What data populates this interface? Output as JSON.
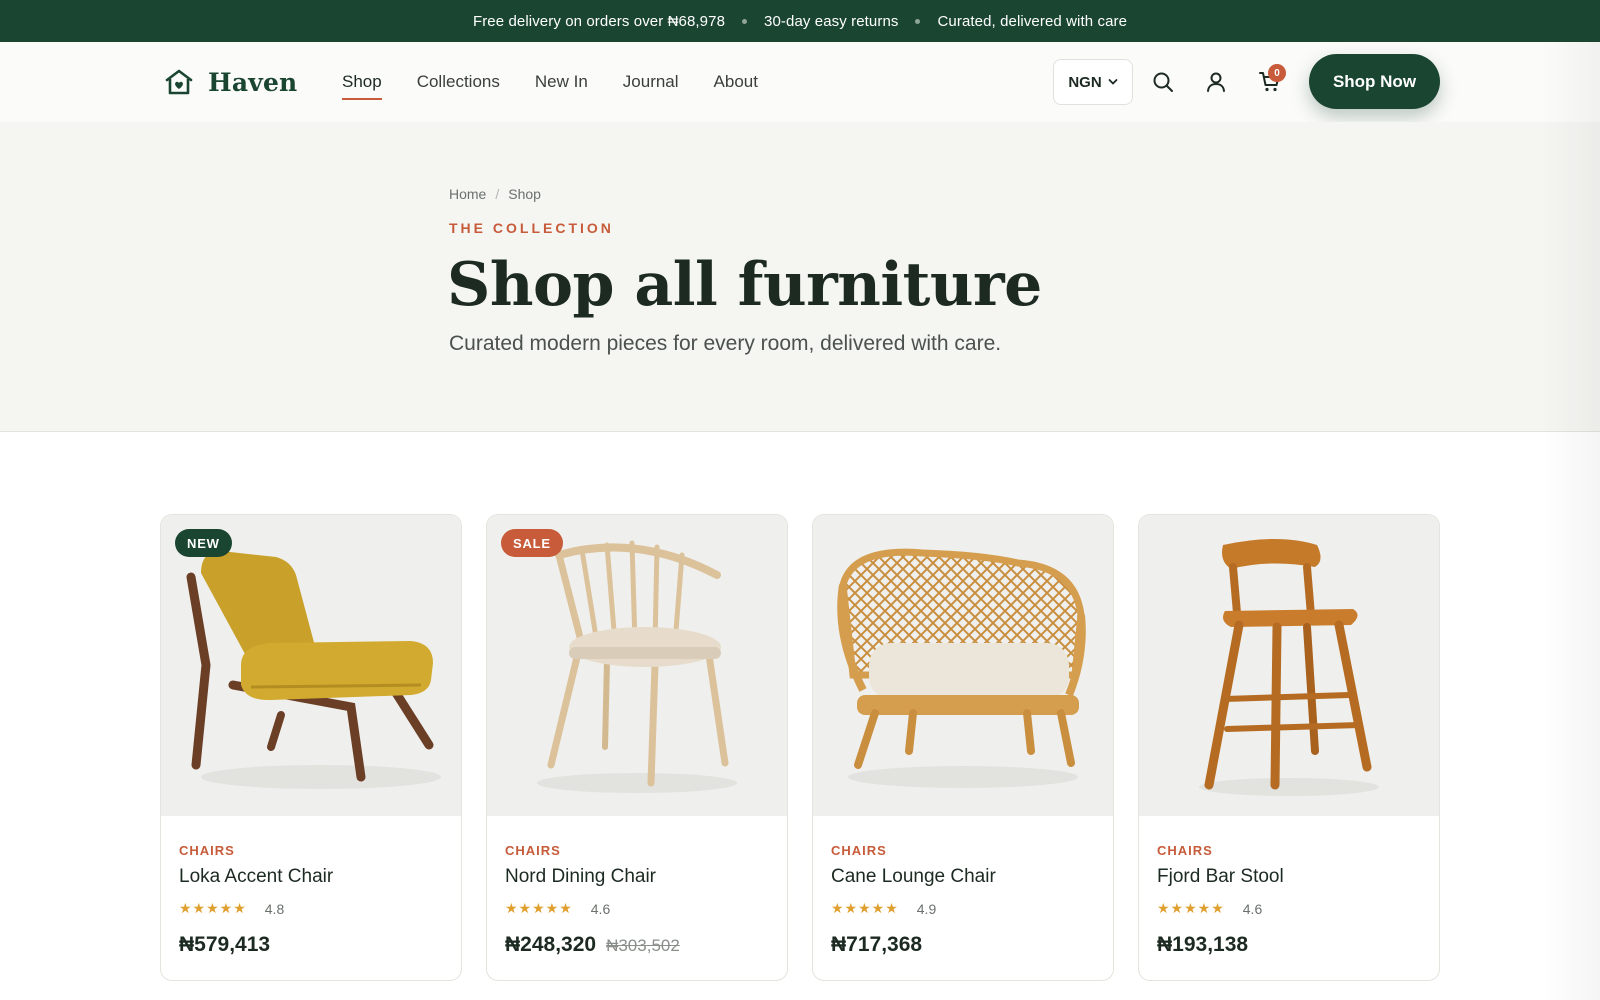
{
  "announcement": {
    "items": [
      "Free delivery on orders over ₦68,978",
      "30-day easy returns",
      "Curated, delivered with care"
    ]
  },
  "header": {
    "brand": "Haven",
    "nav": [
      {
        "label": "Shop",
        "active": true
      },
      {
        "label": "Collections",
        "active": false
      },
      {
        "label": "New In",
        "active": false
      },
      {
        "label": "Journal",
        "active": false
      },
      {
        "label": "About",
        "active": false
      }
    ],
    "currency": "NGN",
    "icons": [
      "search-icon",
      "account-icon",
      "cart-icon"
    ],
    "cart_count": "0",
    "cta_label": "Shop Now"
  },
  "hero": {
    "breadcrumb": [
      "Home",
      "Shop"
    ],
    "eyebrow": "THE COLLECTION",
    "title": "Shop all furniture",
    "subtitle": "Curated modern pieces for every room, delivered with care."
  },
  "products": [
    {
      "badge": "NEW",
      "category": "CHAIRS",
      "name": "Loka Accent Chair",
      "rating_stars": "★★★★★",
      "rating": "4.8",
      "price": "₦579,413",
      "old_price": "",
      "image": "yellow accent lounge chair"
    },
    {
      "badge": "SALE",
      "category": "CHAIRS",
      "name": "Nord Dining Chair",
      "rating_stars": "★★★★★",
      "rating": "4.6",
      "price": "₦248,320",
      "old_price": "₦303,502",
      "image": "spindle-back dining chair"
    },
    {
      "badge": "",
      "category": "CHAIRS",
      "name": "Cane Lounge Chair",
      "rating_stars": "★★★★★",
      "rating": "4.9",
      "price": "₦717,368",
      "old_price": "",
      "image": "rattan lounge chair"
    },
    {
      "badge": "",
      "category": "CHAIRS",
      "name": "Fjord Bar Stool",
      "rating_stars": "★★★★★",
      "rating": "4.6",
      "price": "₦193,138",
      "old_price": "",
      "image": "wooden bar stool"
    }
  ],
  "colors": {
    "brand_green": "#1a4531",
    "accent_terracotta": "#c75b3a",
    "hero_bg": "#f5f5f2",
    "star": "#e0a030"
  }
}
